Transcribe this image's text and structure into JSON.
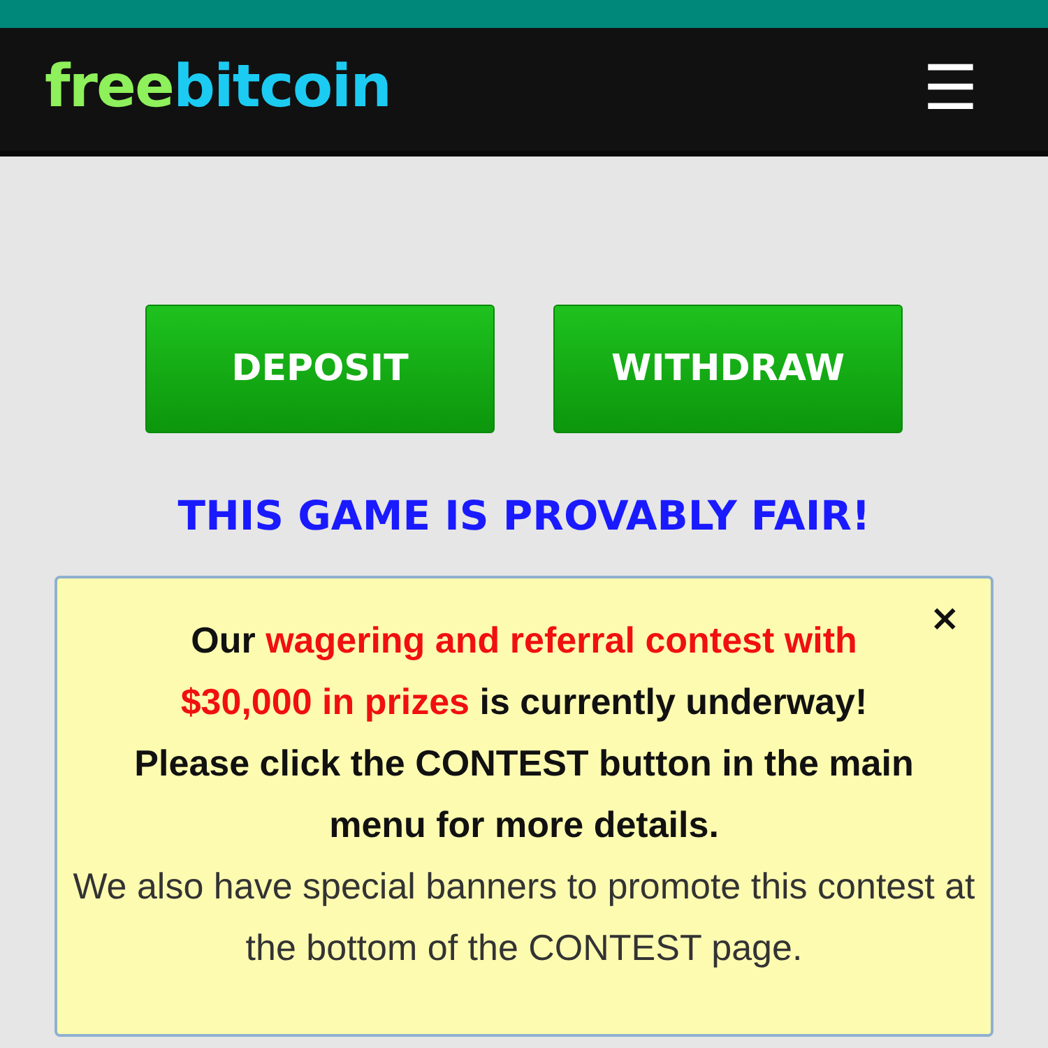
{
  "header": {
    "logo": [
      {
        "text": "free",
        "color": "#8ef05a"
      },
      {
        "text": "bitcoin",
        "color": "#1ccbf2"
      }
    ],
    "menu_icon": "☰"
  },
  "buttons": [
    {
      "label": "DEPOSIT"
    },
    {
      "label": "WITHDRAW"
    }
  ],
  "headline": "THIS GAME IS PROVABLY FAIR!",
  "notice": {
    "close": "×",
    "message": [
      {
        "text": "Our ",
        "highlight": false
      },
      {
        "text": "wagering and referral contest with $30,000 in prizes",
        "highlight": true
      },
      {
        "text": " is currently underway! Please click the CONTEST button in the main menu for more details.",
        "highlight": false
      }
    ],
    "note": "We also have special banners to promote this contest at the bottom of the CONTEST page."
  }
}
